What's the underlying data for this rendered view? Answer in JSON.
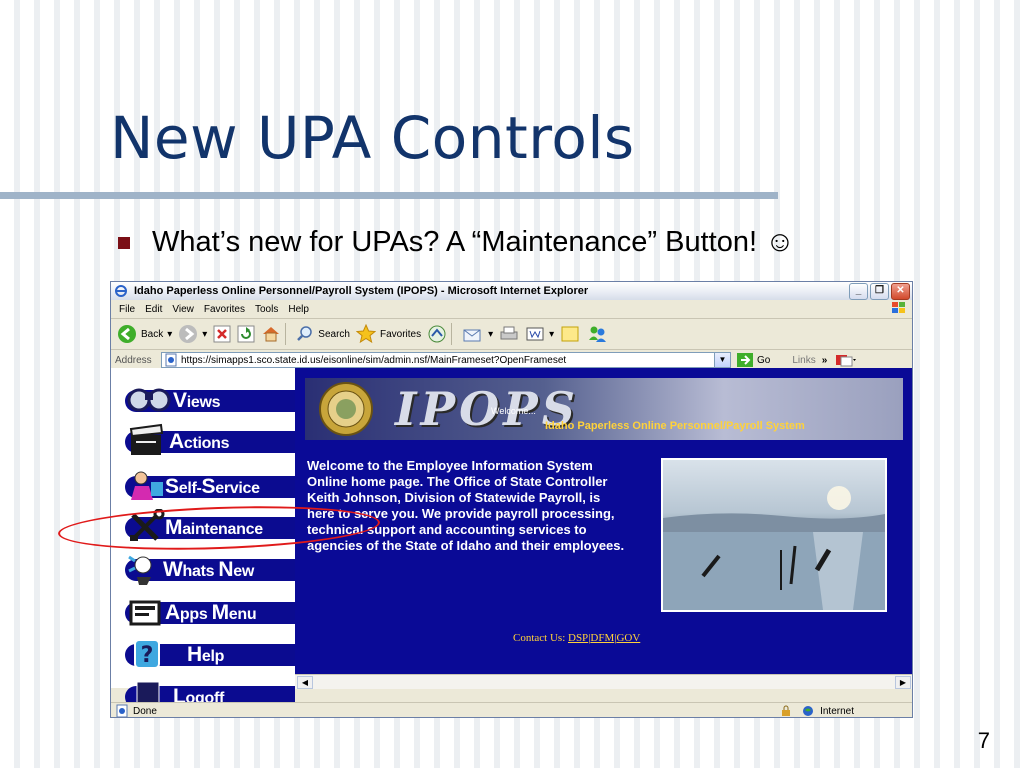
{
  "slide": {
    "title": "New UPA Controls",
    "bullet": "What’s new for UPAs?  A “Maintenance” Button! ☺",
    "page_number": "7"
  },
  "browser": {
    "window_title": "Idaho Paperless Online Personnel/Payroll System (IPOPS) - Microsoft Internet Explorer",
    "menu": [
      "File",
      "Edit",
      "View",
      "Favorites",
      "Tools",
      "Help"
    ],
    "toolbar": {
      "back": "Back",
      "search": "Search",
      "favorites": "Favorites"
    },
    "address_label": "Address",
    "address_url": "https://simapps1.sco.state.id.us/eisonline/sim/admin.nsf/MainFrameset?OpenFrameset",
    "go_label": "Go",
    "links_label": "Links",
    "status_text": "Done",
    "status_zone": "Internet"
  },
  "nav": {
    "views": {
      "first": "V",
      "rest": "iews"
    },
    "actions": {
      "first": "A",
      "rest": "ctions"
    },
    "self_service": {
      "first": "S",
      "mid": "elf-",
      "first2": "S",
      "rest": "ervice"
    },
    "maintenance": {
      "first": "M",
      "rest": "aintenance"
    },
    "whats_new": {
      "first": "W",
      "mid": "hats ",
      "first2": "N",
      "rest": "ew"
    },
    "apps_menu": {
      "first": "A",
      "mid": "pps ",
      "first2": "M",
      "rest": "enu"
    },
    "help": {
      "first": "H",
      "rest": "elp"
    },
    "logoff": {
      "first": "L",
      "rest": "ogoff"
    }
  },
  "page": {
    "banner_logo": "IPOPS",
    "banner_welcome": "Welcome...",
    "banner_subtitle": "Idaho Paperless Online Personnel/Payroll System",
    "welcome_text": "Welcome to the Employee Information System Online home page. The Office of State Controller Keith Johnson, Division of Statewide Payroll, is here to serve you. We provide payroll processing, technical support and accounting services to agencies of the State of Idaho and their employees.",
    "contact_label": "Contact Us:",
    "contact_links": [
      "DSP",
      "DFM",
      "GOV"
    ]
  },
  "colors": {
    "title": "#12346b",
    "nav_blue": "#0b0b90",
    "main_bg": "#0a0a96",
    "highlight": "#e01a1a",
    "accent_yellow": "#ffd23a"
  }
}
